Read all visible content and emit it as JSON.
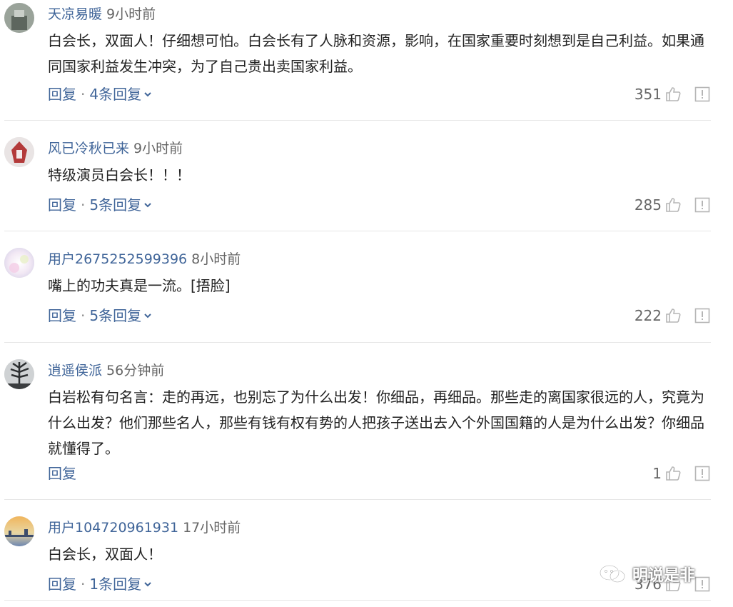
{
  "comments": [
    {
      "username": "天凉易暖",
      "time": "9小时前",
      "text": "白会长，双面人！仔细想可怕。白会长有了人脉和资源，影响，在国家重要时刻想到是自己利益。如果通同国家利益发生冲突，为了自己贵出卖国家利益。",
      "reply_label": "回复",
      "reply_count_label": "4条回复",
      "likes": "351"
    },
    {
      "username": "风已冷秋已来",
      "time": "9小时前",
      "text": "特级演员白会长！！！",
      "reply_label": "回复",
      "reply_count_label": "5条回复",
      "likes": "285"
    },
    {
      "username": "用户2675252599396",
      "time": "8小时前",
      "text": "嘴上的功夫真是一流。[捂脸]",
      "reply_label": "回复",
      "reply_count_label": "5条回复",
      "likes": "222"
    },
    {
      "username": "逍遥侯派",
      "time": "56分钟前",
      "text": "白岩松有句名言：走的再远，也别忘了为什么出发！你细品，再细品。那些走的离国家很远的人，究竟为什么出发？他们那些名人，那些有钱有权有势的人把孩子送出去入个外国国籍的人是为什么出发？你细品就懂得了。",
      "reply_label": "回复",
      "reply_count_label": "",
      "likes": "1"
    },
    {
      "username": "用户104720961931",
      "time": "17小时前",
      "text": "白会长，双面人！",
      "reply_label": "回复",
      "reply_count_label": "1条回复",
      "likes": "376"
    }
  ],
  "separator": "·",
  "watermark": "明说是非",
  "icons": {
    "like": "thumbs-up-icon",
    "report": "report-icon",
    "expand": "chevron-down-icon",
    "watermark": "wechat-icon"
  },
  "colors": {
    "link": "#406599",
    "text": "#222222",
    "meta": "#666666",
    "divider": "#e6e6e6"
  }
}
